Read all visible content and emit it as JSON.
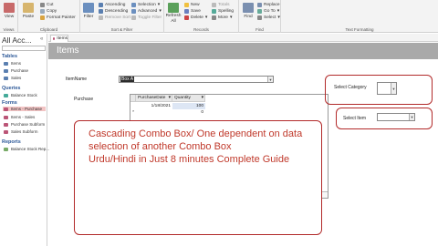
{
  "ribbon": {
    "views": {
      "view_label": "View",
      "group_label": "Views"
    },
    "clipboard": {
      "paste_label": "Paste",
      "cut_label": "Cut",
      "copy_label": "Copy",
      "format_painter_label": "Format Painter",
      "group_label": "Clipboard"
    },
    "sort_filter": {
      "filter_label": "Filter",
      "ascending_label": "Ascending",
      "descending_label": "Descending",
      "remove_sort_label": "Remove Sort",
      "selection_label": "Selection",
      "advanced_label": "Advanced",
      "toggle_filter_label": "Toggle Filter",
      "group_label": "Sort & Filter"
    },
    "records": {
      "refresh_label": "Refresh",
      "refresh_all_label": "All",
      "new_label": "New",
      "save_label": "Save",
      "delete_label": "Delete",
      "totals_label": "Totals",
      "spelling_label": "Spelling",
      "more_label": "More",
      "group_label": "Records"
    },
    "find": {
      "find_label": "Find",
      "replace_label": "Replace",
      "goto_label": "Go To",
      "select_label": "Select",
      "group_label": "Find"
    },
    "text_formatting": {
      "group_label": "Text Formatting"
    }
  },
  "nav": {
    "title": "All Acc...",
    "sections": [
      {
        "name": "Tables",
        "items": [
          "Items",
          "Purchase",
          "Sales"
        ]
      },
      {
        "name": "Queries",
        "items": [
          "Balance Stock"
        ]
      },
      {
        "name": "Forms",
        "items": [
          "Items - Purchase",
          "Items - Sales",
          "Purchase Subform",
          "Sales Subform"
        ]
      },
      {
        "name": "Reports",
        "items": [
          "Balance Stock Rep..."
        ]
      }
    ]
  },
  "tab": {
    "label": "Items"
  },
  "form": {
    "title": "Items",
    "item_name_label": "ItemName",
    "item_name_value": "Box A",
    "purchase_label": "Purchase",
    "select_category_label": "Select Category",
    "select_item_label": "Select Item"
  },
  "subform": {
    "columns": [
      "PurchaseDate",
      "Quantity"
    ],
    "rows": [
      {
        "date": "1/18/2021",
        "qty": "100"
      },
      {
        "date": "",
        "qty": "0"
      }
    ],
    "nav": {
      "record_label": "Record:",
      "position": "1 of 1",
      "filter_label": "No Filter",
      "search_label": "Search"
    }
  },
  "overlay": {
    "lines": [
      "Cascading Combo Box/ One dependent on data",
      "selection of another Combo Box",
      "Urdu/Hindi in Just 8 minutes Complete Guide"
    ]
  },
  "colors": {
    "accent_red": "#b22a2a",
    "overlay_text": "#c0392b",
    "form_header": "#a9a9a9",
    "selected_nav": "#f2c4c4"
  }
}
